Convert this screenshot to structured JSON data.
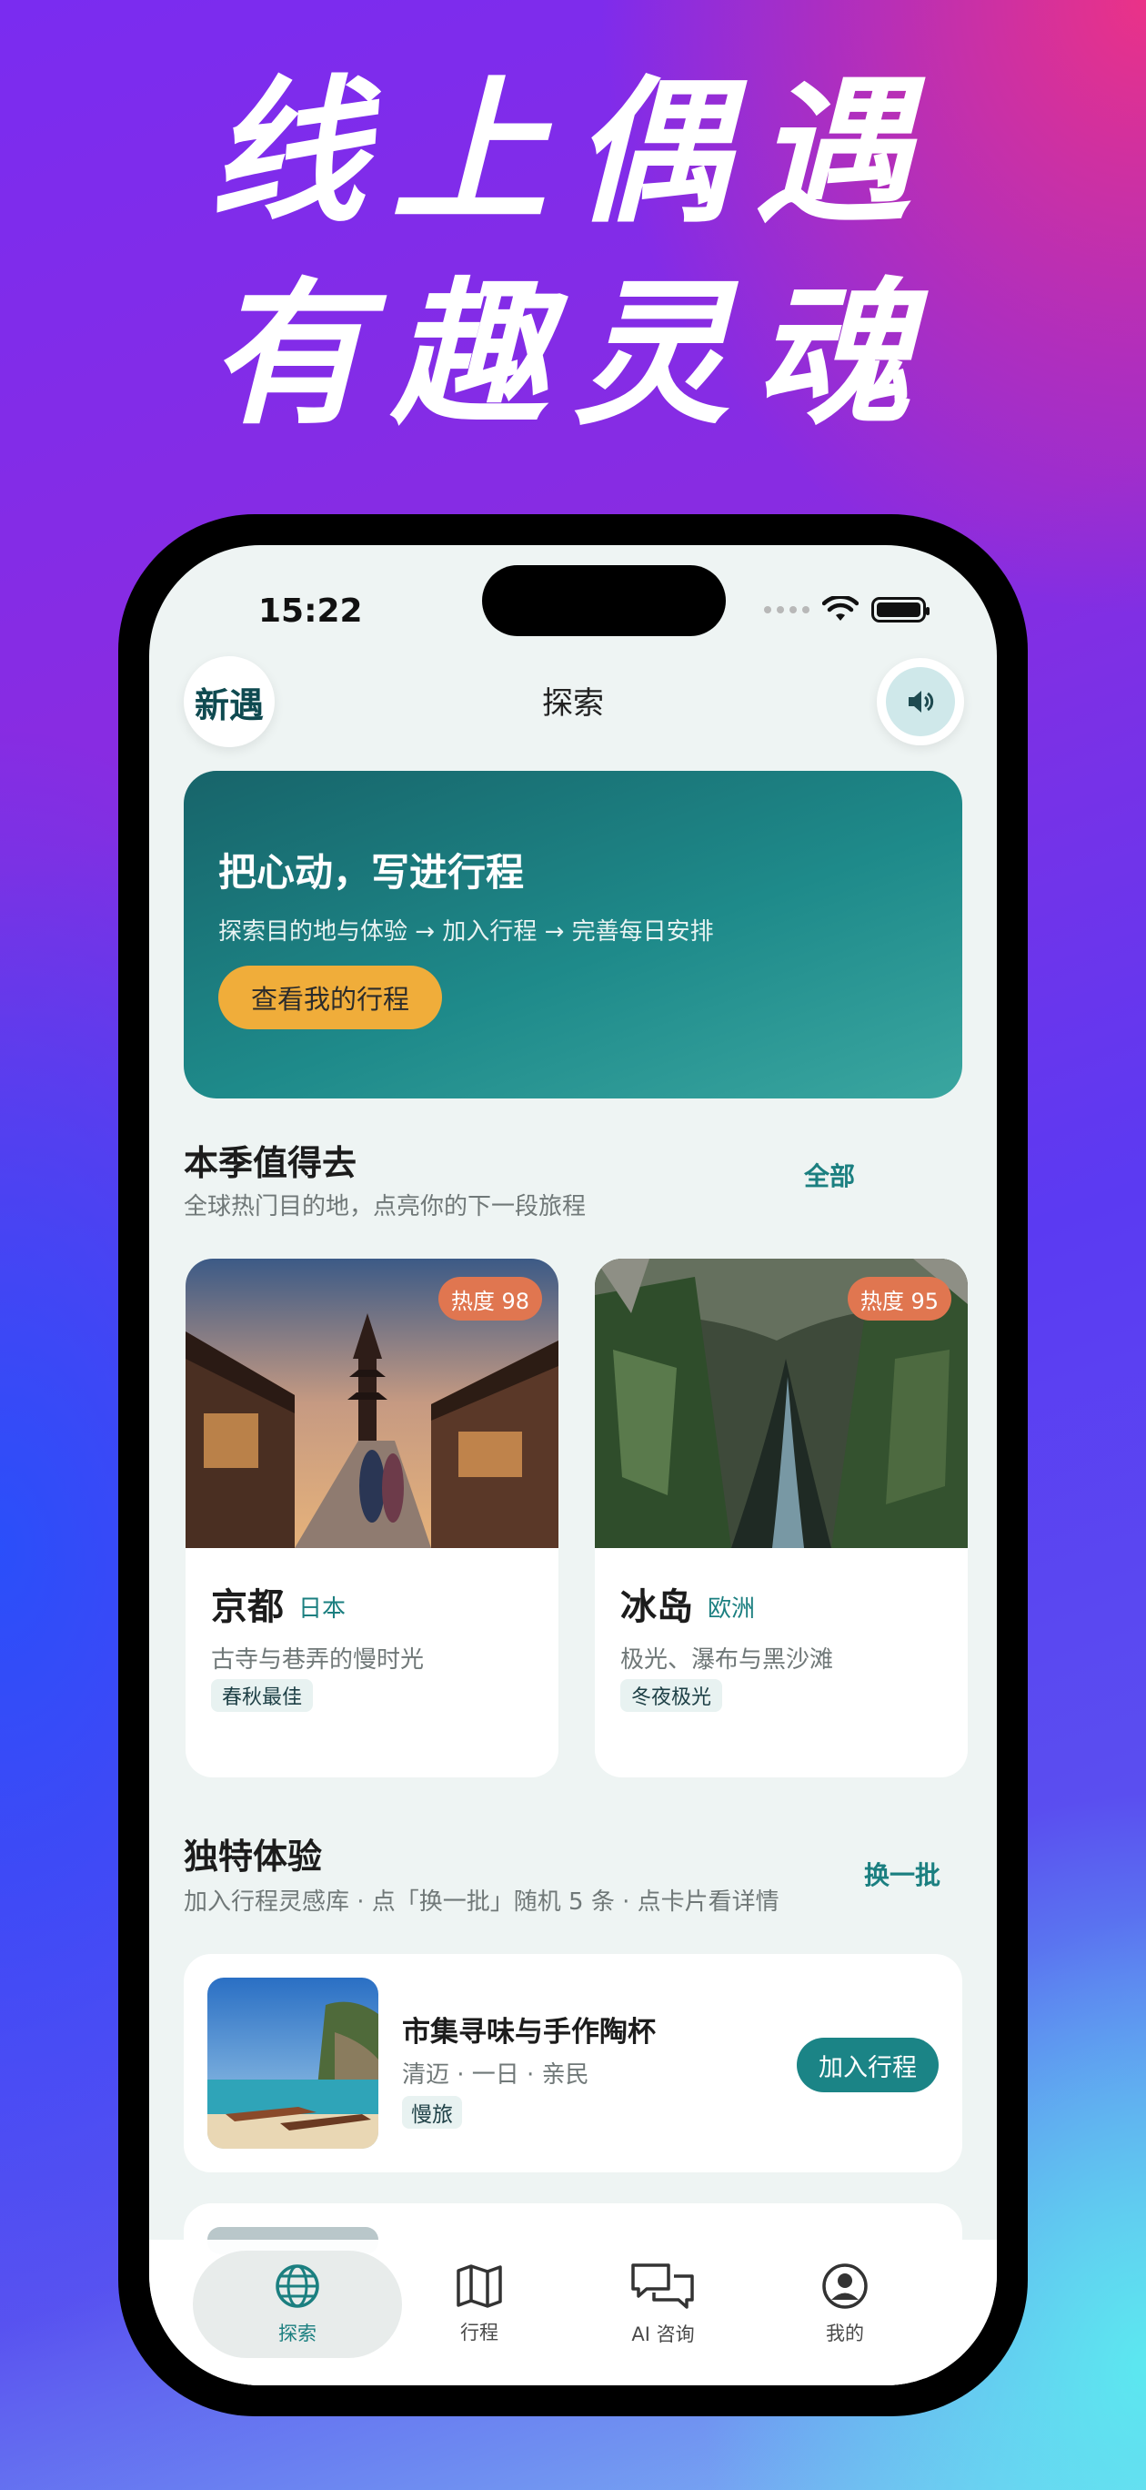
{
  "headline": {
    "line1": "线上偶遇",
    "line2": "有趣灵魂"
  },
  "status_bar": {
    "time": "15:22"
  },
  "header": {
    "logo": "新遇",
    "title": "探索",
    "sound_icon": "speaker-icon"
  },
  "hero": {
    "title": "把心动，写进行程",
    "subtitle": "探索目的地与体验 → 加入行程 → 完善每日安排",
    "button": "查看我的行程"
  },
  "season": {
    "title": "本季值得去",
    "subtitle": "全球热门目的地，点亮你的下一段旅程",
    "link": "全部",
    "destinations": [
      {
        "heat": "热度 98",
        "name": "京都",
        "region": "日本",
        "desc": "古寺与巷弄的慢时光",
        "tag": "春秋最佳"
      },
      {
        "heat": "热度 95",
        "name": "冰岛",
        "region": "欧洲",
        "desc": "极光、瀑布与黑沙滩",
        "tag": "冬夜极光"
      }
    ]
  },
  "experiences": {
    "title": "独特体验",
    "subtitle": "加入行程灵感库 · 点「换一批」随机 5 条 · 点卡片看详情",
    "link": "换一批",
    "items": [
      {
        "title": "市集寻味与手作陶杯",
        "meta": "清迈 · 一日 · 亲民",
        "tag": "慢旅",
        "button": "加入行程"
      }
    ]
  },
  "tabbar": {
    "tabs": [
      {
        "label": "探索",
        "icon": "globe-icon"
      },
      {
        "label": "行程",
        "icon": "map-icon"
      },
      {
        "label": "AI 咨询",
        "icon": "chat-icon"
      },
      {
        "label": "我的",
        "icon": "user-icon"
      }
    ]
  },
  "colors": {
    "accent": "#1b7f80",
    "button": "#f0ad3a",
    "heat": "#e07650"
  }
}
